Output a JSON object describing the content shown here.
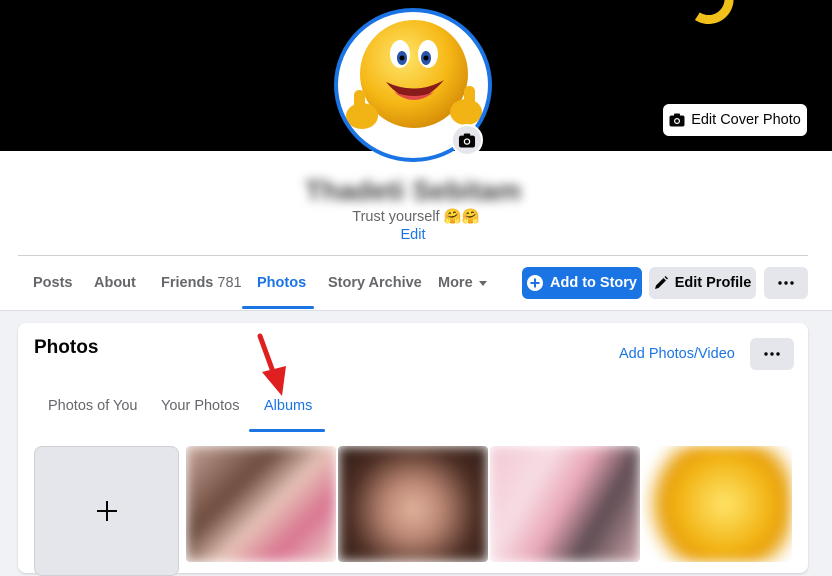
{
  "cover": {
    "edit_cover_label": "Edit Cover Photo",
    "camera_icon": "camera-icon"
  },
  "profile": {
    "name": "Thadeti Sebitam",
    "bio": "Trust yourself 🤗🤗",
    "bio_edit_label": "Edit",
    "avatar": "smiley-thumbs-up",
    "avatar_camera_icon": "camera-icon"
  },
  "tabs": [
    {
      "label": "Posts"
    },
    {
      "label": "About"
    },
    {
      "label": "Friends",
      "count": "781"
    },
    {
      "label": "Photos",
      "active": true
    },
    {
      "label": "Story Archive"
    },
    {
      "label": "More",
      "icon": "caret-down-icon"
    }
  ],
  "actions": {
    "add_to_story": "Add to Story",
    "edit_profile": "Edit Profile",
    "more_icon": "ellipsis-icon"
  },
  "photos": {
    "title": "Photos",
    "add_link": "Add Photos/Video",
    "subtabs": [
      {
        "label": "Photos of You"
      },
      {
        "label": "Your Photos"
      },
      {
        "label": "Albums",
        "active": true
      }
    ],
    "create_album_icon": "plus-icon"
  },
  "colors": {
    "accent": "#1b74e4",
    "annotation_arrow": "#e02020"
  }
}
